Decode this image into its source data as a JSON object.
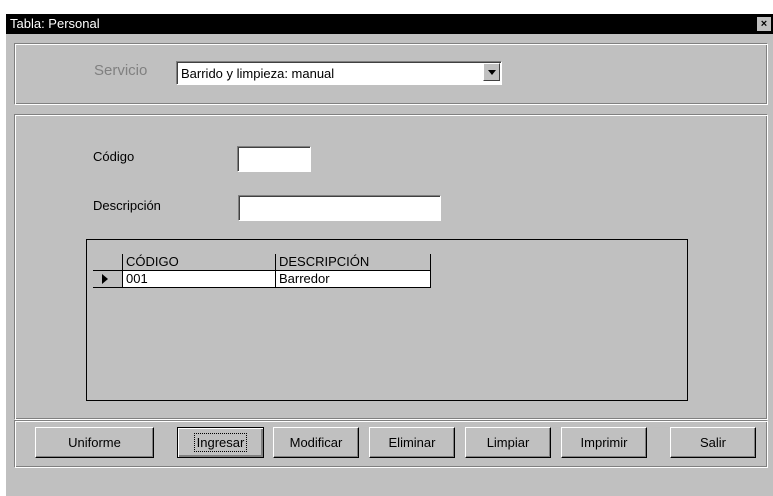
{
  "window": {
    "title": "Tabla: Personal",
    "close_glyph": "×"
  },
  "servicio": {
    "label": "Servicio",
    "selected": "Barrido y limpieza: manual"
  },
  "form": {
    "codigo_label": "Código",
    "codigo_value": "",
    "descripcion_label": "Descripción",
    "descripcion_value": ""
  },
  "grid": {
    "columns": [
      "CÓDIGO",
      "DESCRIPCIÓN"
    ],
    "rows": [
      {
        "codigo": "001",
        "descripcion": "Barredor",
        "current": true
      }
    ]
  },
  "buttons": {
    "uniforme": "Uniforme",
    "ingresar": "Ingresar",
    "modificar": "Modificar",
    "eliminar": "Eliminar",
    "limpiar": "Limpiar",
    "imprimir": "Imprimir",
    "salir": "Salir"
  }
}
